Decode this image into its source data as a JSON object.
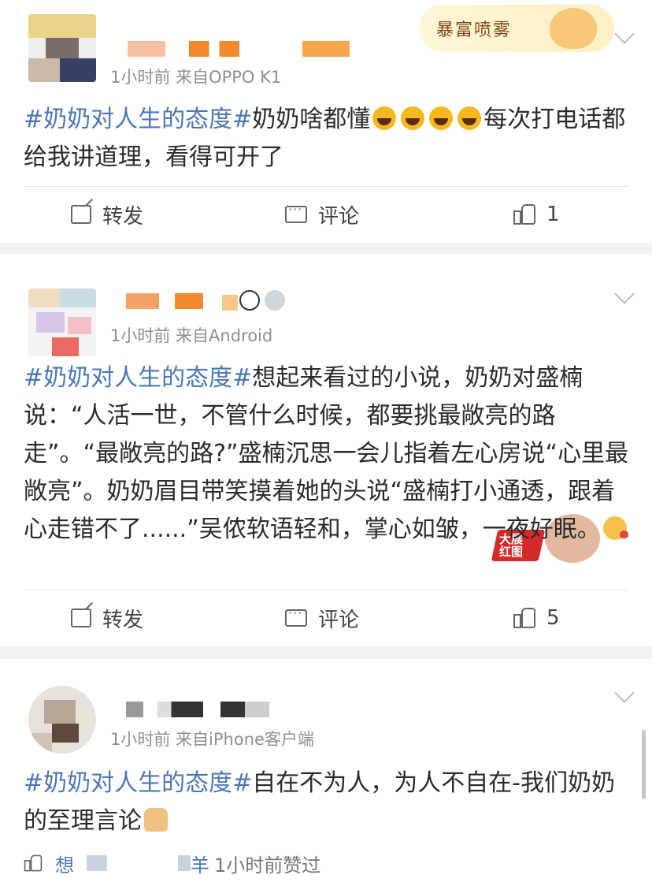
{
  "posts": [
    {
      "meta": "1小时前  来自OPPO K1",
      "tag": "#奶奶对人生的态度#",
      "text_a": "奶奶啥都懂",
      "text_b": "每次打电话都给我讲道理，看得可开了",
      "sticker": "暴富喷雾",
      "actions": {
        "repost": "转发",
        "comment": "评论",
        "like": "1"
      }
    },
    {
      "meta": "1小时前  来自Android",
      "tag": "#奶奶对人生的态度#",
      "text": "想起来看过的小说，奶奶对盛楠说：“人活一世，不管什么时候，都要挑最敞亮的路走”。“最敞亮的路?”盛楠沉思一会儿指着左心房说“心里最敞亮”。奶奶眉目带笑摸着她的头说“盛楠打小通透，跟着心走错不了......”吴侬软语轻和，掌心如皱，一夜好眠。",
      "sticker": "大展红图",
      "actions": {
        "repost": "转发",
        "comment": "评论",
        "like": "5"
      }
    },
    {
      "meta": "1小时前  来自iPhone客户端",
      "tag": "#奶奶对人生的态度#",
      "text": "自在不为人，为人不自在-我们奶奶的至理言论",
      "liked_by": "想",
      "liked_by_end": "羊",
      "liked_text": "1小时前赞过"
    }
  ],
  "icons": [
    "repost-icon",
    "comment-icon",
    "like-icon",
    "chevron-down-icon"
  ],
  "colors": {
    "topic": "#4b77b8",
    "meta": "#8f8f8f",
    "background": "#f2f2f2"
  }
}
